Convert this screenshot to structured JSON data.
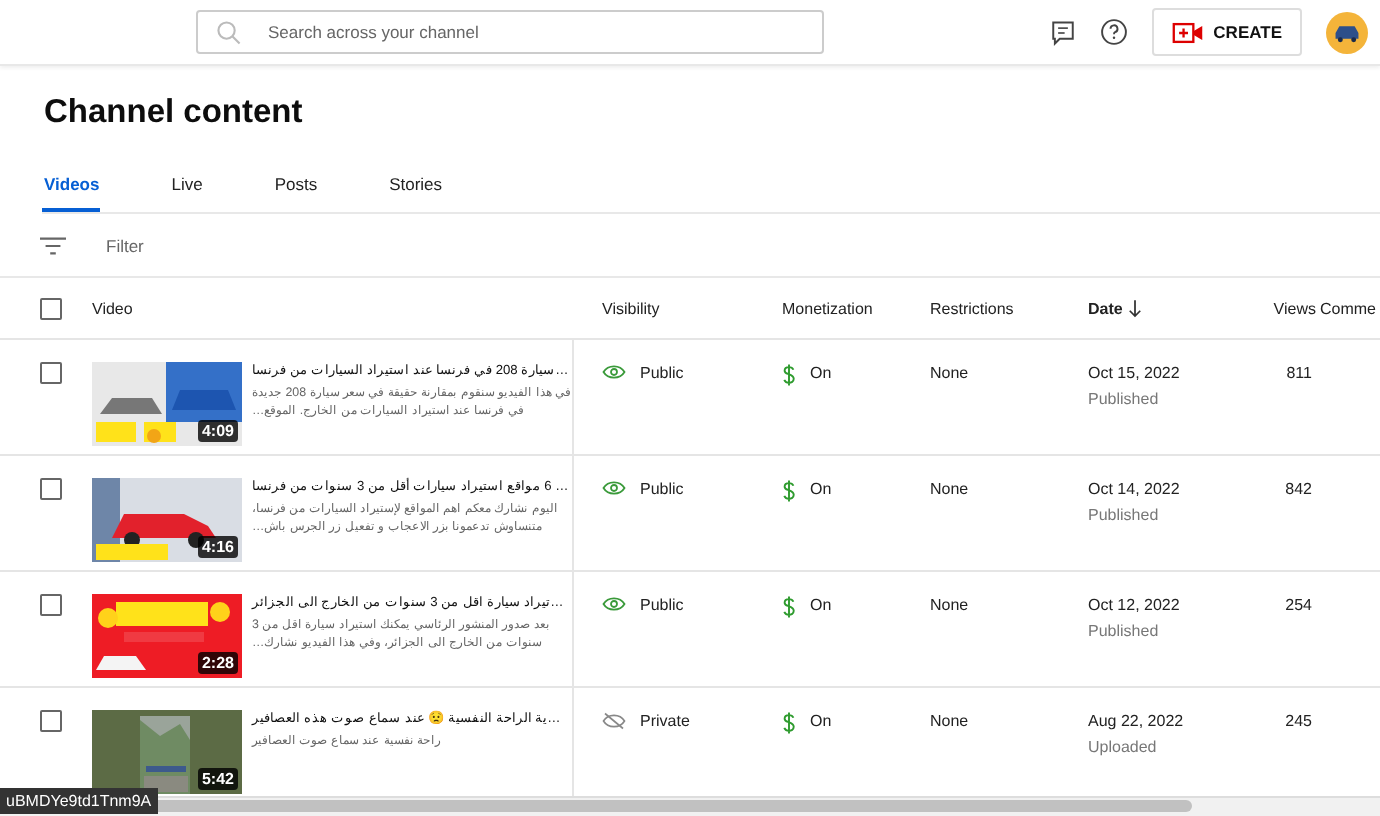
{
  "search": {
    "placeholder": "Search across your channel"
  },
  "create_button": "CREATE",
  "page_title": "Channel content",
  "tabs": [
    {
      "label": "Videos",
      "selected": true
    },
    {
      "label": "Live",
      "selected": false
    },
    {
      "label": "Posts",
      "selected": false
    },
    {
      "label": "Stories",
      "selected": false
    }
  ],
  "filter": {
    "placeholder": "Filter"
  },
  "table": {
    "select_all_checked": false,
    "columns": [
      {
        "label": "Video",
        "sorted": false
      },
      {
        "label": "Visibility",
        "sorted": false
      },
      {
        "label": "Monetization",
        "sorted": false
      },
      {
        "label": "Restrictions",
        "sorted": false
      },
      {
        "label": "Date",
        "sorted": true
      },
      {
        "label": "Views",
        "sorted": false
      },
      {
        "label": "Comme",
        "sorted": false
      }
    ],
    "rows": [
      {
        "checked": false,
        "thumbnail": {
          "kind": "picture",
          "duration": "4:09"
        },
        "title": "…سيارة 208 في فرنسا عند استيراد السيارات من فرنسا",
        "description": "في هذا الفيديو سنقوم بمقارنة حقيقة في سعر سيارة 208 جديدة في فرنسا عند استيراد السيارات من الخارج. الموقع…",
        "visibility": {
          "label": "Public",
          "kind": "public"
        },
        "monetization": "On",
        "restrictions": "None",
        "date": "Oct 15, 2022",
        "date_status": "Published",
        "views": "811"
      },
      {
        "checked": false,
        "thumbnail": {
          "kind": "picture",
          "duration": "4:16"
        },
        "title": "… 6 مواقع استيراد سيارات أقل من 3 سنوات من فرنسا",
        "description": "اليوم نشارك معكم اهم المواقع لإستيراد السيارات من فرنسا، متنساوش تدعمونا بزر الاعجاب و تفعيل زر الجرس باش…",
        "visibility": {
          "label": "Public",
          "kind": "public"
        },
        "monetization": "On",
        "restrictions": "None",
        "date": "Oct 14, 2022",
        "date_status": "Published",
        "views": "842"
      },
      {
        "checked": false,
        "thumbnail": {
          "kind": "picture",
          "duration": "2:28"
        },
        "title": "…تيراد سيارة اقل من 3 سنوات من الخارج الى الجزائر",
        "description": "بعد صدور المنشور الرئاسي يمكنك استيراد سيارة اقل من 3 سنوات من الخارج الى الجزائر، وفي هذا الفيديو نشارك…",
        "visibility": {
          "label": "Public",
          "kind": "public"
        },
        "monetization": "On",
        "restrictions": "None",
        "date": "Oct 12, 2022",
        "date_status": "Published",
        "views": "254"
      },
      {
        "checked": false,
        "thumbnail": {
          "kind": "picture",
          "duration": "5:42"
        },
        "title": "…ية الراحة النفسية 😟 عند سماع صوت هذه العصافير",
        "description": "راحة نفسية عند سماع صوت العصافير",
        "visibility": {
          "label": "Private",
          "kind": "private"
        },
        "monetization": "On",
        "restrictions": "None",
        "date": "Aug 22, 2022",
        "date_status": "Uploaded",
        "views": "245"
      }
    ]
  },
  "status_tooltip": "uBMDYe9td1Tnm9A"
}
